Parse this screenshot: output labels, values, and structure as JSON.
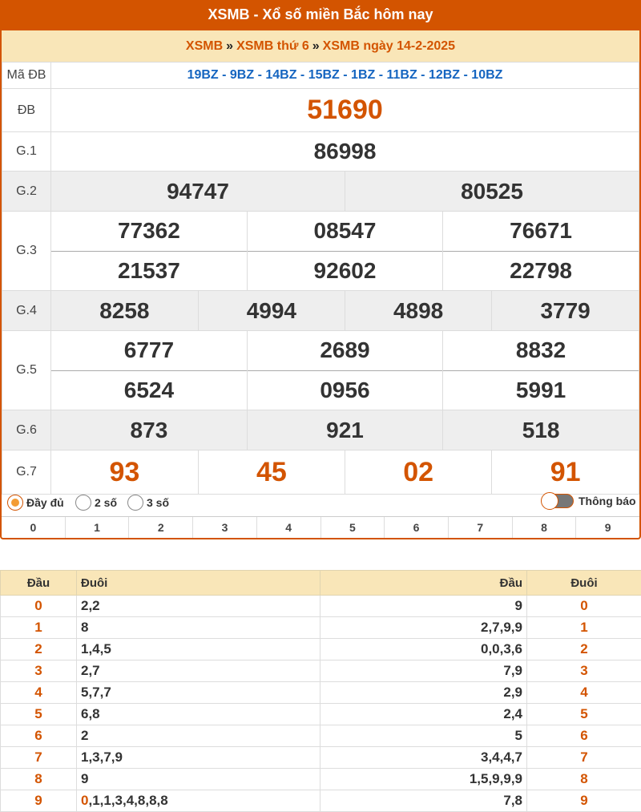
{
  "header": {
    "title": "XSMB - Xổ số miền Bắc hôm nay"
  },
  "breadcrumb": {
    "items": [
      "XSMB",
      "XSMB thứ 6",
      "XSMB ngày 14-2-2025"
    ],
    "sep": "»"
  },
  "results": {
    "code_label": "Mã ĐB",
    "codes": "19BZ - 9BZ - 14BZ - 15BZ - 1BZ - 11BZ - 12BZ - 10BZ",
    "db": {
      "label": "ĐB",
      "value": "51690"
    },
    "g1": {
      "label": "G.1",
      "values": [
        "86998"
      ]
    },
    "g2": {
      "label": "G.2",
      "values": [
        "94747",
        "80525"
      ]
    },
    "g3": {
      "label": "G.3",
      "values": [
        "77362",
        "08547",
        "76671",
        "21537",
        "92602",
        "22798"
      ]
    },
    "g4": {
      "label": "G.4",
      "values": [
        "8258",
        "4994",
        "4898",
        "3779"
      ]
    },
    "g5": {
      "label": "G.5",
      "values": [
        "6777",
        "2689",
        "8832",
        "6524",
        "0956",
        "5991"
      ]
    },
    "g6": {
      "label": "G.6",
      "values": [
        "873",
        "921",
        "518"
      ]
    },
    "g7": {
      "label": "G.7",
      "values": [
        "93",
        "45",
        "02",
        "91"
      ]
    }
  },
  "options": {
    "full": "Đầy đủ",
    "two": "2 số",
    "three": "3 số",
    "selected": "full",
    "notify": "Thông báo"
  },
  "digits": [
    "0",
    "1",
    "2",
    "3",
    "4",
    "5",
    "6",
    "7",
    "8",
    "9"
  ],
  "loto": {
    "headers": [
      "Đầu",
      "Đuôi",
      "Đầu",
      "Đuôi"
    ],
    "rows": [
      {
        "dau": "0",
        "duoi": "2,2",
        "rdau": "9",
        "rduoi": "0"
      },
      {
        "dau": "1",
        "duoi": "8",
        "rdau": "2,7,9,9",
        "rduoi": "1"
      },
      {
        "dau": "2",
        "duoi": "1,4,5",
        "rdau": "0,0,3,6",
        "rduoi": "2"
      },
      {
        "dau": "3",
        "duoi": "2,7",
        "rdau": "7,9",
        "rduoi": "3"
      },
      {
        "dau": "4",
        "duoi": "5,7,7",
        "rdau": "2,9",
        "rduoi": "4"
      },
      {
        "dau": "5",
        "duoi": "6,8",
        "rdau": "2,4",
        "rduoi": "5"
      },
      {
        "dau": "6",
        "duoi": "2",
        "rdau": "5",
        "rduoi": "6"
      },
      {
        "dau": "7",
        "duoi": "1,3,7,9",
        "rdau": "3,4,4,7",
        "rduoi": "7"
      },
      {
        "dau": "8",
        "duoi": "9",
        "rdau": "1,5,9,9,9",
        "rduoi": "8"
      },
      {
        "dau": "9",
        "duoi_hl": "0",
        "duoi": ",1,1,3,4,8,8,8",
        "rdau": "7,8",
        "rduoi": "9"
      }
    ]
  }
}
